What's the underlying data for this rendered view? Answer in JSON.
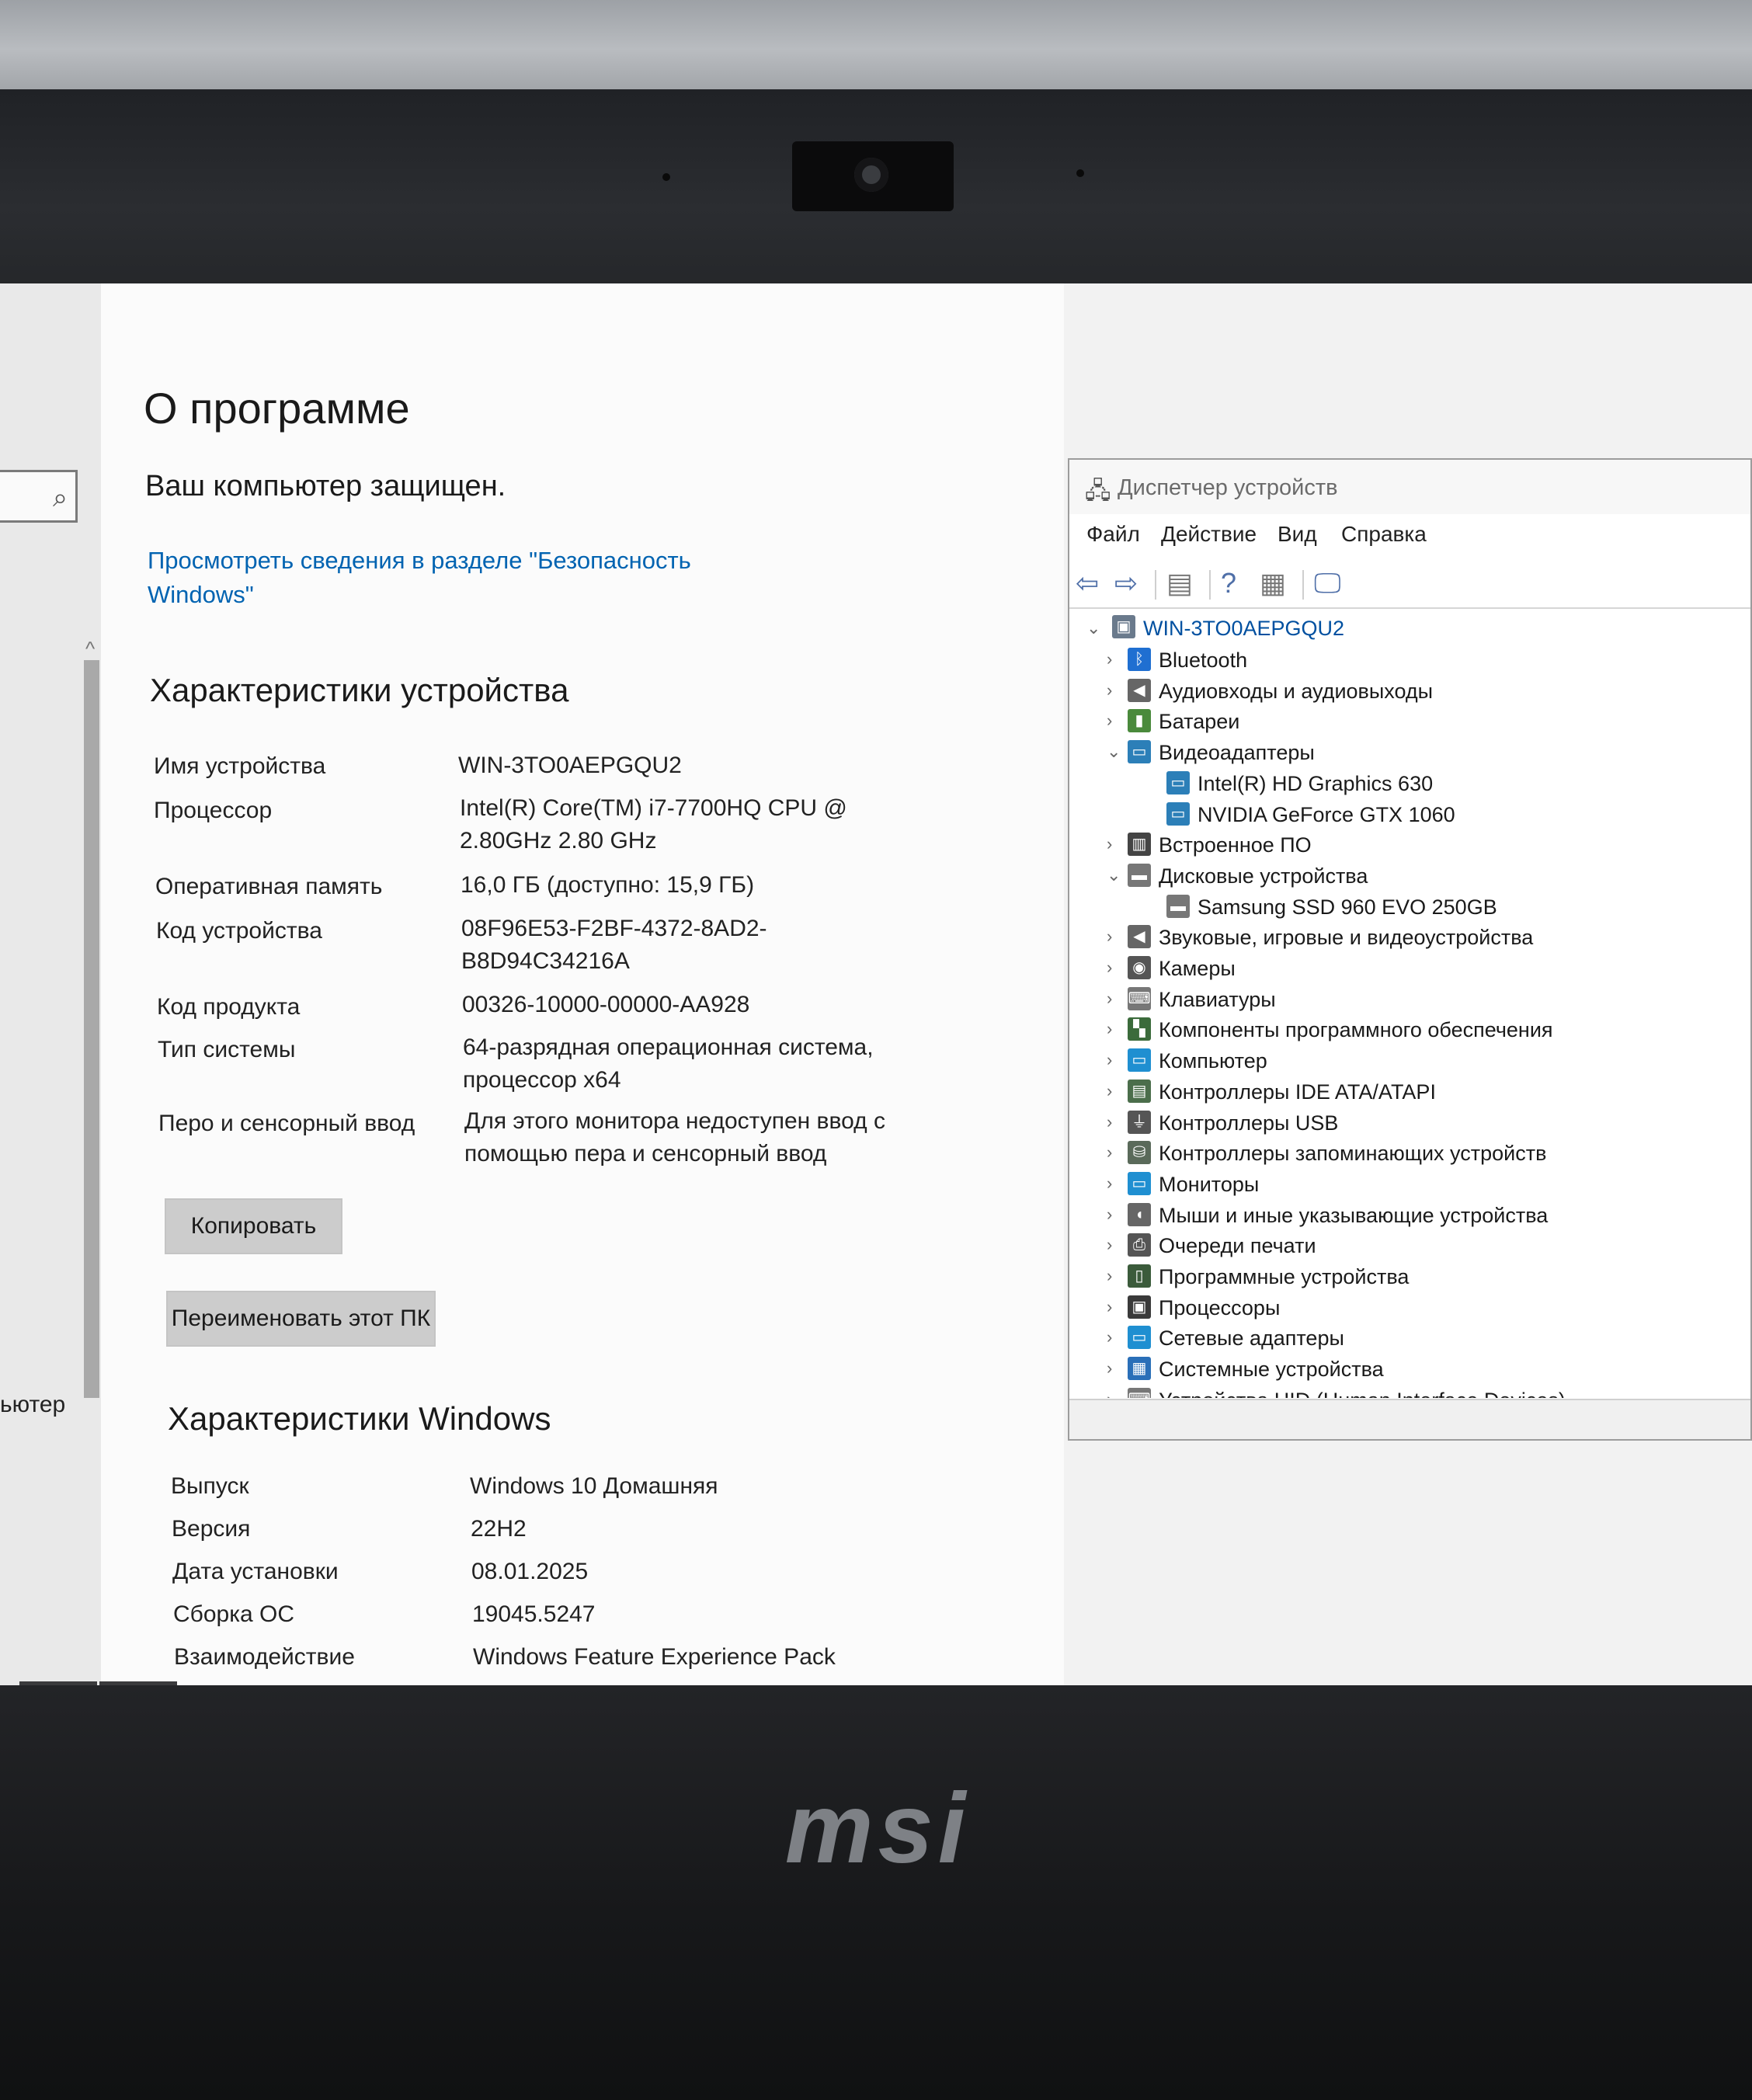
{
  "brand": "msi",
  "settings": {
    "title": "О программе",
    "security_status": "Ваш компьютер защищен.",
    "security_link": "Просмотреть сведения в разделе \"Безопасность Windows\"",
    "nav_partial_label": "ьютер",
    "device_specs": {
      "heading": "Характеристики устройства",
      "rows": [
        {
          "label": "Имя устройства",
          "value": "WIN-3TO0AEPGQU2"
        },
        {
          "label": "Процессор",
          "value": "Intel(R) Core(TM) i7-7700HQ CPU @ 2.80GHz   2.80 GHz"
        },
        {
          "label": "Оперативная память",
          "value": "16,0 ГБ (доступно: 15,9 ГБ)"
        },
        {
          "label": "Код устройства",
          "value": "08F96E53-F2BF-4372-8AD2-B8D94C34216A"
        },
        {
          "label": "Код продукта",
          "value": "00326-10000-00000-AA928"
        },
        {
          "label": "Тип системы",
          "value": "64-разрядная операционная система, процессор x64"
        },
        {
          "label": "Перо и сенсорный ввод",
          "value": "Для этого монитора недоступен ввод с помощью пера и сенсорный ввод"
        }
      ],
      "copy_button": "Копировать",
      "rename_button": "Переименовать этот ПК"
    },
    "windows_specs": {
      "heading": "Характеристики Windows",
      "rows": [
        {
          "label": "Выпуск",
          "value": "Windows 10 Домашняя"
        },
        {
          "label": "Версия",
          "value": "22H2"
        },
        {
          "label": "Дата установки",
          "value": "08.01.2025"
        },
        {
          "label": "Сборка ОС",
          "value": "19045.5247"
        },
        {
          "label": "Взаимодействие",
          "value": "Windows Feature Experience Pack"
        }
      ]
    }
  },
  "device_manager": {
    "title": "Диспетчер устройств",
    "menu": [
      "Файл",
      "Действие",
      "Вид",
      "Справка"
    ],
    "root": "WIN-3TO0AEPGQU2",
    "nodes": [
      {
        "label": "Bluetooth",
        "icon": "bluetooth-icon",
        "expanded": false
      },
      {
        "label": "Аудиовходы и аудиовыходы",
        "icon": "speaker-icon",
        "expanded": false
      },
      {
        "label": "Батареи",
        "icon": "battery-icon",
        "expanded": false
      },
      {
        "label": "Видеоадаптеры",
        "icon": "display-adapter-icon",
        "expanded": true
      },
      {
        "label": "Intel(R) HD Graphics 630",
        "icon": "display-adapter-icon",
        "child": true
      },
      {
        "label": "NVIDIA GeForce GTX 1060",
        "icon": "display-adapter-icon",
        "child": true
      },
      {
        "label": "Встроенное ПО",
        "icon": "firmware-icon",
        "expanded": false
      },
      {
        "label": "Дисковые устройства",
        "icon": "disk-icon",
        "expanded": true
      },
      {
        "label": "Samsung SSD 960 EVO 250GB",
        "icon": "disk-icon",
        "child": true
      },
      {
        "label": "Звуковые, игровые и видеоустройства",
        "icon": "speaker-icon",
        "expanded": false
      },
      {
        "label": "Камеры",
        "icon": "camera-icon",
        "expanded": false
      },
      {
        "label": "Клавиатуры",
        "icon": "keyboard-icon",
        "expanded": false
      },
      {
        "label": "Компоненты программного обеспечения",
        "icon": "software-component-icon",
        "expanded": false
      },
      {
        "label": "Компьютер",
        "icon": "monitor-icon",
        "expanded": false
      },
      {
        "label": "Контроллеры IDE ATA/ATAPI",
        "icon": "ide-controller-icon",
        "expanded": false
      },
      {
        "label": "Контроллеры USB",
        "icon": "usb-icon",
        "expanded": false
      },
      {
        "label": "Контроллеры запоминающих устройств",
        "icon": "storage-controller-icon",
        "expanded": false
      },
      {
        "label": "Мониторы",
        "icon": "monitor-icon",
        "expanded": false
      },
      {
        "label": "Мыши и иные указывающие устройства",
        "icon": "mouse-icon",
        "expanded": false
      },
      {
        "label": "Очереди печати",
        "icon": "printer-icon",
        "expanded": false
      },
      {
        "label": "Программные устройства",
        "icon": "software-device-icon",
        "expanded": false
      },
      {
        "label": "Процессоры",
        "icon": "cpu-icon",
        "expanded": false
      },
      {
        "label": "Сетевые адаптеры",
        "icon": "network-icon",
        "expanded": false
      },
      {
        "label": "Системные устройства",
        "icon": "system-device-icon",
        "expanded": false
      },
      {
        "label": "Устройства HID (Human Interface Devices)",
        "icon": "hid-icon",
        "expanded": false
      }
    ]
  },
  "colors": {
    "link": "#0063b1",
    "tree_root": "#0050a0",
    "adapter": "#2c7fb8"
  }
}
